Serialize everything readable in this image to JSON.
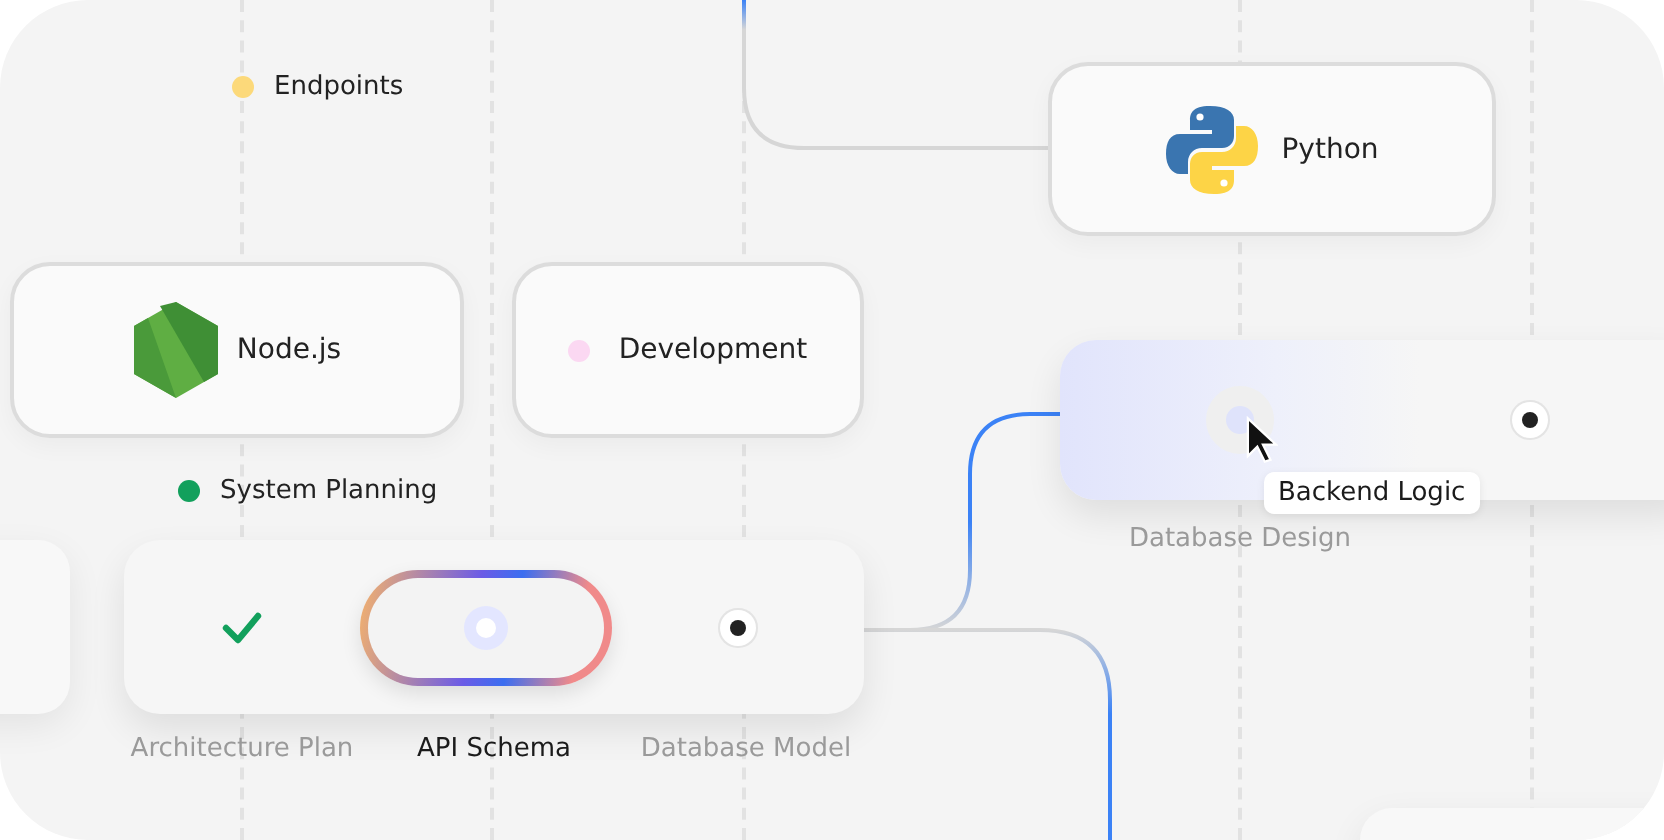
{
  "labels": [
    {
      "text": "Endpoints",
      "color": "#fcd97a"
    },
    {
      "text": "System Planning",
      "color": "#12a05c"
    }
  ],
  "nodes": [
    {
      "kind": "nodejs",
      "text": "Node.js"
    },
    {
      "kind": "dot",
      "text": "Development",
      "color": "#fbd8f2"
    },
    {
      "kind": "python",
      "text": "Python"
    }
  ],
  "pipelines": [
    {
      "kind": "pill",
      "steps": [
        {
          "kind": "done",
          "label": "Architecture Plan",
          "selected": false
        },
        {
          "kind": "current",
          "label": "API Schema",
          "selected": true
        },
        {
          "kind": "pending",
          "label": "Database Model",
          "selected": false
        }
      ]
    },
    {
      "kind": "glow",
      "steps": [
        {
          "kind": "current",
          "label": "Database Design",
          "selected": false,
          "tooltip": "Backend Logic"
        },
        {
          "kind": "pending"
        }
      ]
    }
  ]
}
